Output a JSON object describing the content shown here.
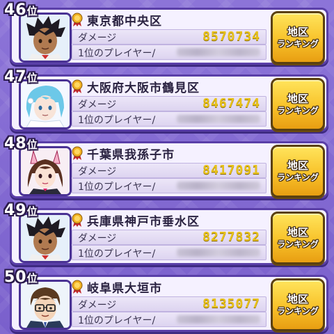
{
  "rank_suffix": "位",
  "labels": {
    "damage": "ダメージ",
    "top_player": "1位のプレイヤー/",
    "button_line1": "地区",
    "button_line2": "ランキング"
  },
  "entries": [
    {
      "rank": "46",
      "region": "東京都中央区",
      "damage": "8570734",
      "avatar": "dark-hair-boy-avatar"
    },
    {
      "rank": "47",
      "region": "大阪府大阪市鶴見区",
      "damage": "8467474",
      "avatar": "blue-hair-girl-avatar"
    },
    {
      "rank": "48",
      "region": "千葉県我孫子市",
      "damage": "8417091",
      "avatar": "bunny-ear-girl-avatar"
    },
    {
      "rank": "49",
      "region": "兵庫県神戸市垂水区",
      "damage": "8277832",
      "avatar": "dark-hair-boy-avatar"
    },
    {
      "rank": "50",
      "region": "岐阜県大垣市",
      "damage": "8135077",
      "avatar": "glasses-man-avatar"
    }
  ],
  "colors": {
    "background": "#7f66d0",
    "card": "#f5f1ff",
    "score": "#e8c21a",
    "button": "#f8c22a"
  }
}
